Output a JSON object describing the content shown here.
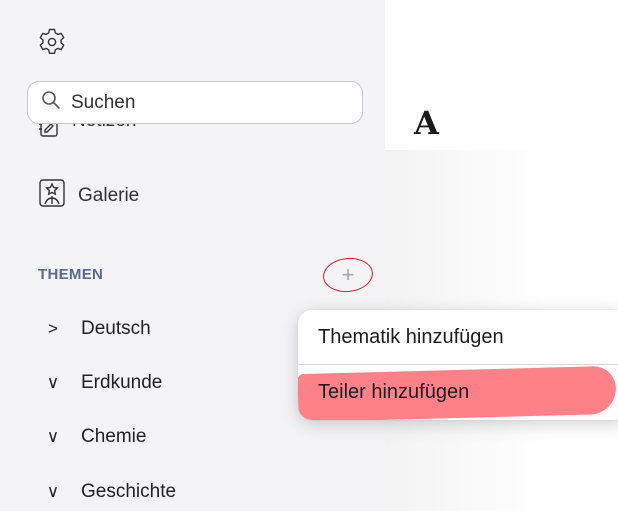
{
  "sidebar": {
    "settings_icon": "gear-icon",
    "notes": {
      "icon": "notes-icon",
      "label": "Notizen"
    },
    "search": {
      "icon": "search-icon",
      "placeholder": "Suchen"
    },
    "gallery": {
      "icon": "gallery-icon",
      "label": "Galerie"
    },
    "topics_section": {
      "title": "THEMEN",
      "add_icon": "plus-icon",
      "add_label": "+"
    },
    "topics": [
      {
        "label": "Deutsch",
        "state": "collapsed",
        "chevron": ">"
      },
      {
        "label": "Erdkunde",
        "state": "expanded",
        "chevron": "∨"
      },
      {
        "label": "Chemie",
        "state": "expanded",
        "chevron": "∨"
      },
      {
        "label": "Geschichte",
        "state": "expanded",
        "chevron": "∨"
      }
    ]
  },
  "main": {
    "heading": "A"
  },
  "context_menu": {
    "items": [
      {
        "label": "Thematik hinzufügen"
      },
      {
        "label": "Teiler hinzufügen",
        "highlighted": true
      }
    ]
  },
  "colors": {
    "sidebar_bg": "#f4f4f6",
    "section_title": "#5a6a8c",
    "annotation_circle": "#e0202c",
    "annotation_highlight": "#ff505a"
  }
}
